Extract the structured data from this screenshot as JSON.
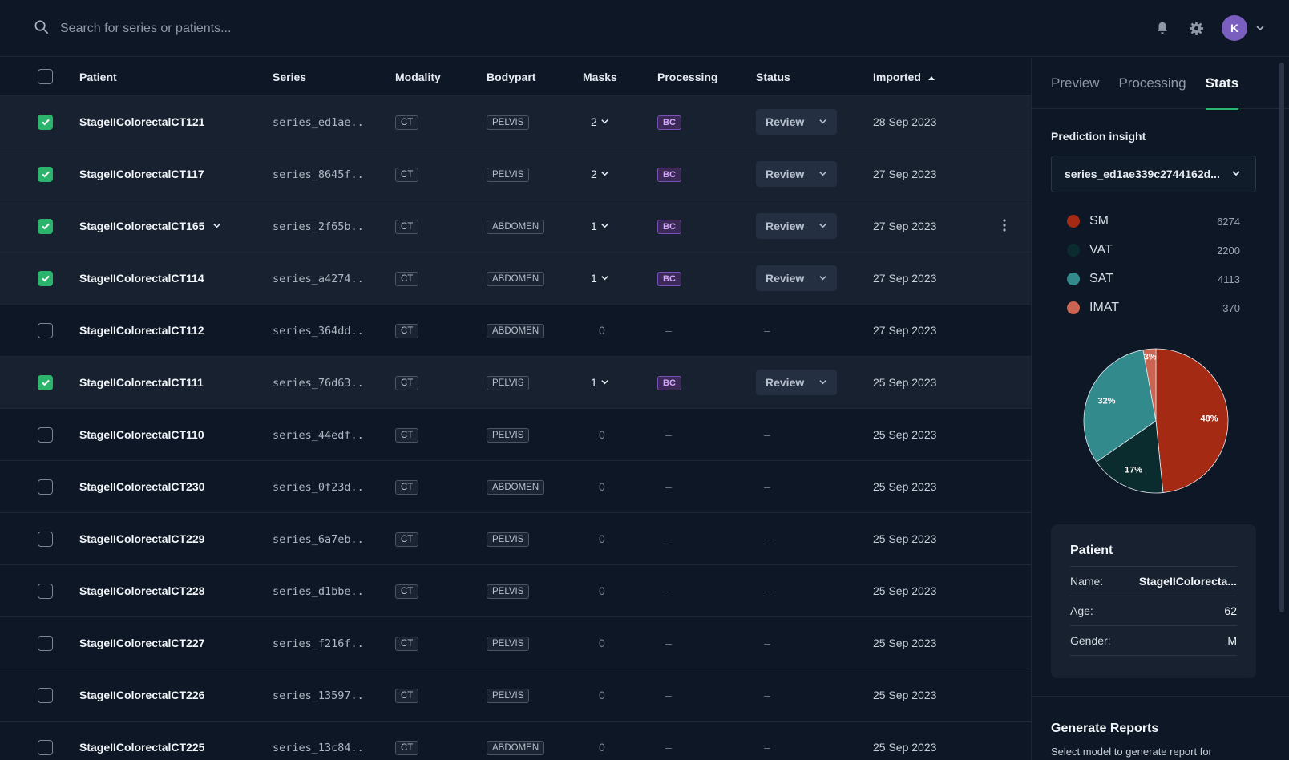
{
  "search": {
    "placeholder": "Search for series or patients..."
  },
  "user": {
    "initial": "K"
  },
  "table": {
    "headers": {
      "patient": "Patient",
      "series": "Series",
      "modality": "Modality",
      "bodypart": "Bodypart",
      "masks": "Masks",
      "processing": "Processing",
      "status": "Status",
      "imported": "Imported"
    },
    "rows": [
      {
        "checked": true,
        "patient": "StageIIColorectalCT121",
        "series": "series_ed1ae..",
        "modality": "CT",
        "bodypart": "PELVIS",
        "masks": "2",
        "processing": "BC",
        "status": "Review",
        "imported": "28 Sep 2023"
      },
      {
        "checked": true,
        "patient": "StageIIColorectalCT117",
        "series": "series_8645f..",
        "modality": "CT",
        "bodypart": "PELVIS",
        "masks": "2",
        "processing": "BC",
        "status": "Review",
        "imported": "27 Sep 2023"
      },
      {
        "checked": true,
        "patient": "StageIIColorectalCT165",
        "series": "series_2f65b..",
        "modality": "CT",
        "bodypart": "ABDOMEN",
        "masks": "1",
        "processing": "BC",
        "status": "Review",
        "imported": "27 Sep 2023",
        "expand": true,
        "more": true
      },
      {
        "checked": true,
        "patient": "StageIIColorectalCT114",
        "series": "series_a4274..",
        "modality": "CT",
        "bodypart": "ABDOMEN",
        "masks": "1",
        "processing": "BC",
        "status": "Review",
        "imported": "27 Sep 2023"
      },
      {
        "checked": false,
        "patient": "StageIIColorectalCT112",
        "series": "series_364dd..",
        "modality": "CT",
        "bodypart": "ABDOMEN",
        "masks": "0",
        "processing": "–",
        "status": "–",
        "imported": "27 Sep 2023"
      },
      {
        "checked": true,
        "patient": "StageIIColorectalCT111",
        "series": "series_76d63..",
        "modality": "CT",
        "bodypart": "PELVIS",
        "masks": "1",
        "processing": "BC",
        "status": "Review",
        "imported": "25 Sep 2023"
      },
      {
        "checked": false,
        "patient": "StageIIColorectalCT110",
        "series": "series_44edf..",
        "modality": "CT",
        "bodypart": "PELVIS",
        "masks": "0",
        "processing": "–",
        "status": "–",
        "imported": "25 Sep 2023"
      },
      {
        "checked": false,
        "patient": "StageIIColorectalCT230",
        "series": "series_0f23d..",
        "modality": "CT",
        "bodypart": "ABDOMEN",
        "masks": "0",
        "processing": "–",
        "status": "–",
        "imported": "25 Sep 2023"
      },
      {
        "checked": false,
        "patient": "StageIIColorectalCT229",
        "series": "series_6a7eb..",
        "modality": "CT",
        "bodypart": "PELVIS",
        "masks": "0",
        "processing": "–",
        "status": "–",
        "imported": "25 Sep 2023"
      },
      {
        "checked": false,
        "patient": "StageIIColorectalCT228",
        "series": "series_d1bbe..",
        "modality": "CT",
        "bodypart": "PELVIS",
        "masks": "0",
        "processing": "–",
        "status": "–",
        "imported": "25 Sep 2023"
      },
      {
        "checked": false,
        "patient": "StageIIColorectalCT227",
        "series": "series_f216f..",
        "modality": "CT",
        "bodypart": "PELVIS",
        "masks": "0",
        "processing": "–",
        "status": "–",
        "imported": "25 Sep 2023"
      },
      {
        "checked": false,
        "patient": "StageIIColorectalCT226",
        "series": "series_13597..",
        "modality": "CT",
        "bodypart": "PELVIS",
        "masks": "0",
        "processing": "–",
        "status": "–",
        "imported": "25 Sep 2023"
      },
      {
        "checked": false,
        "patient": "StageIIColorectalCT225",
        "series": "series_13c84..",
        "modality": "CT",
        "bodypart": "ABDOMEN",
        "masks": "0",
        "processing": "–",
        "status": "–",
        "imported": "25 Sep 2023"
      }
    ]
  },
  "side": {
    "tabs": [
      "Preview",
      "Processing",
      "Stats"
    ],
    "active_tab": "Stats",
    "insight_title": "Prediction insight",
    "series_select": "series_ed1ae339c2744162d...",
    "legend": [
      {
        "name": "SM",
        "value": "6274",
        "color": "#a52a13"
      },
      {
        "name": "VAT",
        "value": "2200",
        "color": "#0b2c2e"
      },
      {
        "name": "SAT",
        "value": "4113",
        "color": "#328a8c"
      },
      {
        "name": "IMAT",
        "value": "370",
        "color": "#c96550"
      }
    ],
    "patient_card": {
      "title": "Patient",
      "name_label": "Name:",
      "name": "StageIIColorecta...",
      "age_label": "Age:",
      "age": "62",
      "gender_label": "Gender:",
      "gender": "M"
    },
    "reports": {
      "title": "Generate Reports",
      "text": "Select model to generate report for"
    }
  },
  "chart_data": {
    "type": "pie",
    "categories": [
      "SM",
      "VAT",
      "SAT",
      "IMAT"
    ],
    "values": [
      6274,
      2200,
      4113,
      370
    ],
    "labels": [
      "48%",
      "17%",
      "32%",
      "3%"
    ],
    "colors": [
      "#a52a13",
      "#0b2c2e",
      "#328a8c",
      "#c96550"
    ]
  }
}
